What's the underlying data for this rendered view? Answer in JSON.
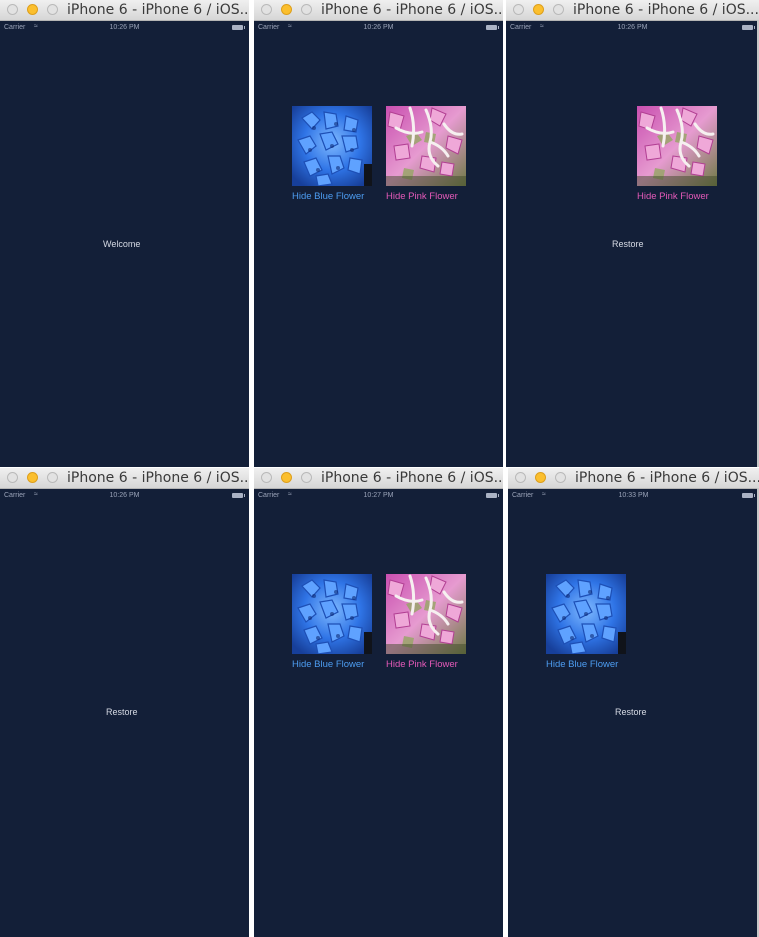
{
  "window_title": "iPhone 6 - iPhone 6 / iOS...",
  "status_bar": {
    "carrier": "Carrier",
    "wifi_icon": "wifi-icon",
    "battery_icon": "battery-icon"
  },
  "buttons": {
    "hide_blue": "Hide Blue Flower",
    "hide_pink": "Hide Pink Flower",
    "restore": "Restore"
  },
  "welcome_label": "Welcome",
  "panels": [
    {
      "time": "10:26 PM"
    },
    {
      "time": "10:26 PM"
    },
    {
      "time": "10:26 PM"
    },
    {
      "time": "10:26 PM"
    },
    {
      "time": "10:27 PM"
    },
    {
      "time": "10:33 PM"
    }
  ],
  "colors": {
    "screen_background": "#131f38",
    "blue_button": "#4d9df2",
    "pink_button": "#e55ab9",
    "title_bar": "#e4e4e4"
  }
}
